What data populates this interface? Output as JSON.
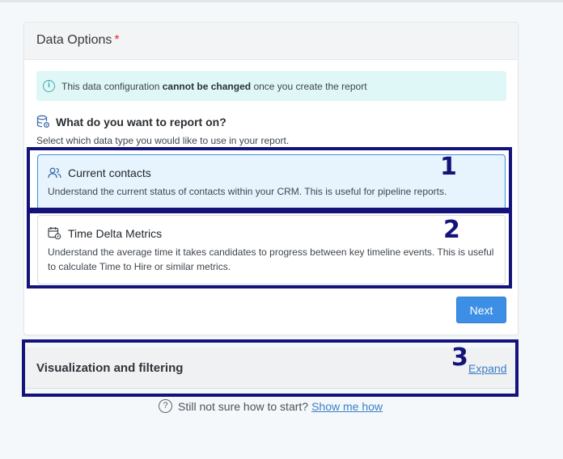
{
  "data_options": {
    "title": "Data Options",
    "required_marker": "*",
    "info": {
      "icon": "info-icon",
      "text_before": "This data configuration ",
      "text_bold": "cannot be changed",
      "text_after": " once you create the report"
    },
    "question": "What do you want to report on?",
    "subtitle": "Select which data type you would like to use in your report.",
    "options": [
      {
        "icon": "users-icon",
        "title": "Current contacts",
        "description": "Understand the current status of contacts within your CRM. This is useful for pipeline reports.",
        "selected": true
      },
      {
        "icon": "calendar-gear-icon",
        "title": "Time Delta Metrics",
        "description": "Understand the average time it takes candidates to progress between key timeline events. This is useful to calculate Time to Hire or similar metrics.",
        "selected": false
      }
    ],
    "next_label": "Next"
  },
  "visualization": {
    "title": "Visualization and filtering",
    "expand_label": "Expand"
  },
  "help": {
    "text": "Still not sure how to start?",
    "link": "Show me how"
  },
  "annotations": [
    "1",
    "2",
    "3"
  ],
  "colors": {
    "accent": "#3d8fe6",
    "info_bg": "#dff7f6",
    "selected_bg": "#e8f4fd",
    "annotation": "#14137a",
    "required": "#e0303a"
  }
}
